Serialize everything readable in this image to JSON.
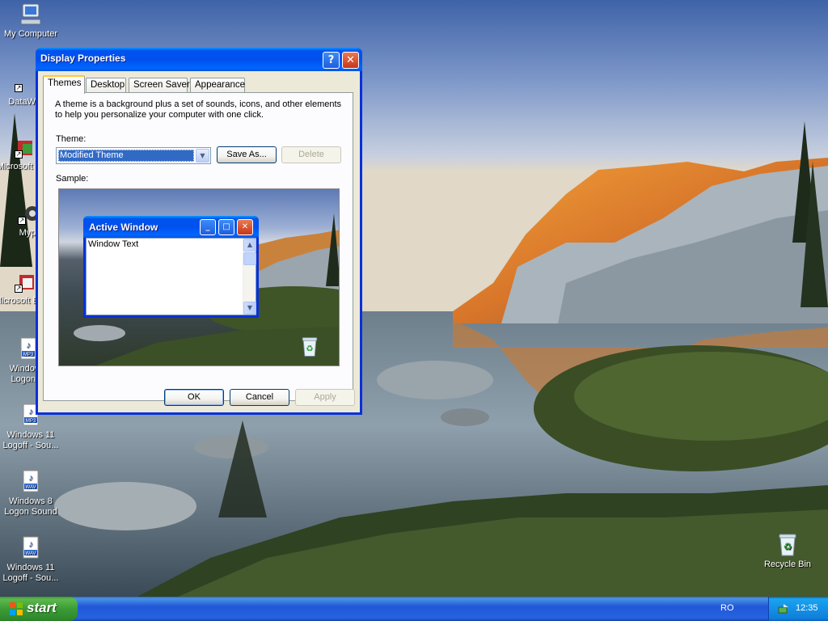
{
  "desktop": {
    "icons": [
      {
        "label": "My Computer",
        "icon": "my-computer-icon"
      },
      {
        "label": "DataWa",
        "icon": "shortcut-icon"
      },
      {
        "label": "Microsoft C++",
        "icon": "shortcut-icon"
      },
      {
        "label": "Myp",
        "icon": "shortcut-icon"
      },
      {
        "label": "Microsoft Basic",
        "icon": "shortcut-icon"
      },
      {
        "label": "Windows Logon S",
        "icon": "audio-file-icon",
        "badge": "MP3"
      },
      {
        "label": "Windows 11 Logoff - Sou...",
        "icon": "audio-file-icon",
        "badge": "MP3"
      },
      {
        "label": "Windows 8 Logon Sound",
        "icon": "audio-file-icon",
        "badge": "WAV"
      },
      {
        "label": "Windows 11 Logoff - Sou...",
        "icon": "audio-file-icon",
        "badge": "WAV"
      },
      {
        "label": "Recycle Bin",
        "icon": "recycle-bin-icon"
      }
    ]
  },
  "dialog": {
    "title": "Display Properties",
    "help_glyph": "?",
    "close_glyph": "✕",
    "tabs": [
      {
        "label": "Themes",
        "active": true
      },
      {
        "label": "Desktop",
        "active": false
      },
      {
        "label": "Screen Saver",
        "active": false
      },
      {
        "label": "Appearance",
        "active": false
      }
    ],
    "description": "A theme is a background plus a set of sounds, icons, and other elements to help you personalize your computer with one click.",
    "theme_label": "Theme:",
    "theme_value": "Modified Theme",
    "save_as_label": "Save As...",
    "delete_label": "Delete",
    "sample_label": "Sample:",
    "sample": {
      "window_title": "Active Window",
      "window_text": "Window Text"
    },
    "ok_label": "OK",
    "cancel_label": "Cancel",
    "apply_label": "Apply"
  },
  "taskbar": {
    "start_label": "start",
    "language": "RO",
    "clock": "12:35"
  },
  "colors": {
    "title_bar": "#0054e3",
    "start_button": "#3c9a3c",
    "taskbar": "#245edb",
    "dialog_face": "#ece9d8"
  }
}
